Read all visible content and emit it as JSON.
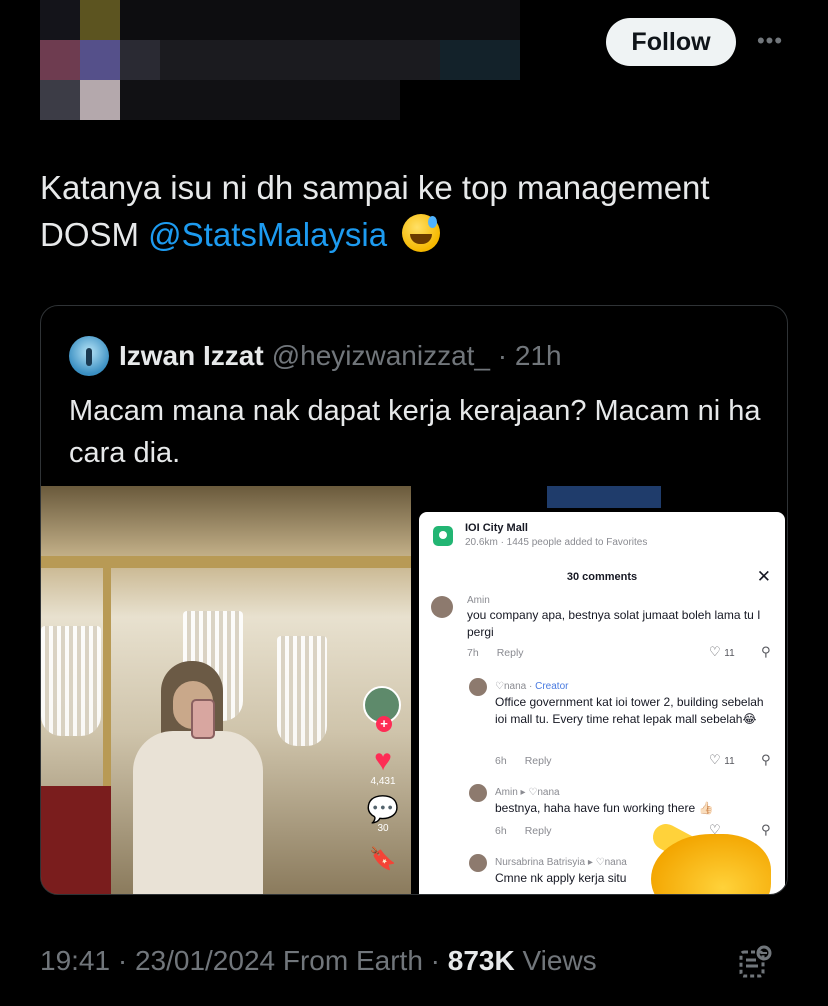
{
  "header": {
    "follow_label": "Follow",
    "more_label": "•••"
  },
  "tweet": {
    "text_line1": "Katanya isu ni dh sampai  ke top management",
    "text_line2_prefix": "DOSM ",
    "mention": "@StatsMalaysia"
  },
  "quote": {
    "name": "Izwan Izzat",
    "handle": "@heyizwanizzat_ · 21h",
    "text": "Macam mana nak dapat kerja kerajaan? Macam ni ha cara dia."
  },
  "tiktok": {
    "like_count": "4,431",
    "comment_count": "30",
    "location_name": "IOI City Mall",
    "location_sub": "20.6km · 1445 people added to Favorites",
    "comments_title": "30 comments",
    "comments": [
      {
        "user": "Amin",
        "text": "you company apa, bestnya solat jumaat boleh lama tu I pergi",
        "age": "7h",
        "reply": "Reply",
        "likes": "11"
      },
      {
        "user": "♡nana",
        "creator": "Creator",
        "text": "Office government kat ioi tower 2, building sebelah ioi mall tu. Every time rehat lepak mall sebelah😂",
        "age": "6h",
        "reply": "Reply",
        "likes": "11"
      },
      {
        "user": "Amin ▸ ♡nana",
        "text": "bestnya, haha have fun working there 👍🏻",
        "age": "6h",
        "reply": "Reply"
      },
      {
        "user": "Nursabrina Batrisyia ▸ ♡nana",
        "text": "Cmne nk apply kerja situ"
      }
    ]
  },
  "footer": {
    "time": "19:41 · 23/01/2024 From Earth · ",
    "views_count": "873K",
    "views_label": " Views"
  },
  "colors": {
    "background": "#000000",
    "text": "#e7e9ea",
    "muted": "#71767b",
    "link": "#1d9bf0",
    "border": "#2f3336"
  }
}
